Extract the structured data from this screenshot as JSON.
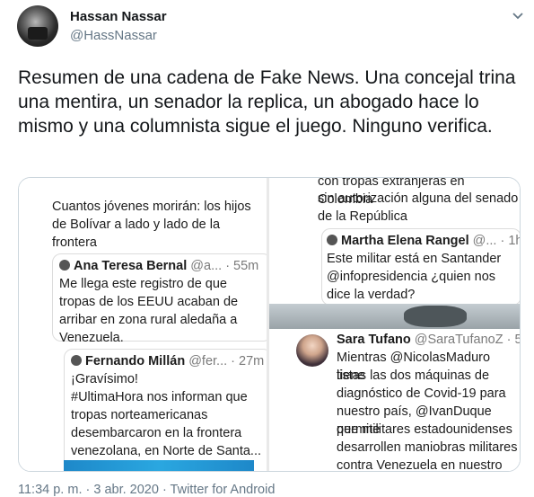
{
  "author": {
    "display_name": "Hassan Nassar",
    "handle": "@HassNassar"
  },
  "tweet": {
    "text": "Resumen de una cadena de Fake News. Una concejal trina una mentira, un senador la replica, un abogado hace lo mismo y una columnista sigue el juego. Ninguno verifica."
  },
  "media": {
    "left": {
      "line1": "Cuantos jóvenes morirán: los hijos",
      "line2": "de Bolívar a lado y lado de la",
      "line3": "frontera",
      "quote1": {
        "name": "Ana Teresa Bernal",
        "meta": "@a... · 55m",
        "l1": "Me llega este registro de que",
        "l2": "tropas de los EEUU acaban de",
        "l3": "arribar en zona rural aledaña a",
        "l4": "Venezuela."
      },
      "quote2": {
        "name": "Fernando Millán",
        "meta": "@fer... · 27m",
        "l1": "¡Gravísimo!",
        "l2": "#UltimaHora nos informan que",
        "l3": "tropas norteamericanas",
        "l4": "desembarcaron en la frontera",
        "l5": "venezolana, en Norte de Santa..."
      }
    },
    "right": {
      "top_l1": "con tropas extranjeras en Colombia",
      "top_l2": "sin autorización alguna del senado",
      "top_l3": "de la República",
      "quote1": {
        "name": "Martha Elena Rangel",
        "meta": "@... · 1h",
        "l1": "Este militar está en Santander",
        "l2": "@infopresidencia ¿quien nos",
        "l3": "dice la verdad?"
      },
      "third": {
        "name": "Sara Tufano",
        "meta": "@SaraTufanoZ · 5m",
        "l1": "Mientras @NicolasMaduro tiene",
        "l2": "listas las dos máquinas de",
        "l3": "diagnóstico de Covid-19 para",
        "l4": "nuestro país, @IvanDuque permite",
        "l5": "que militares estadounidenses",
        "l6": "desarrollen maniobras militares",
        "l7": "contra Venezuela en nuestro"
      }
    }
  },
  "footer": {
    "time": "11:34 p. m. · 3 abr. 2020 · ",
    "source": "Twitter for Android"
  }
}
